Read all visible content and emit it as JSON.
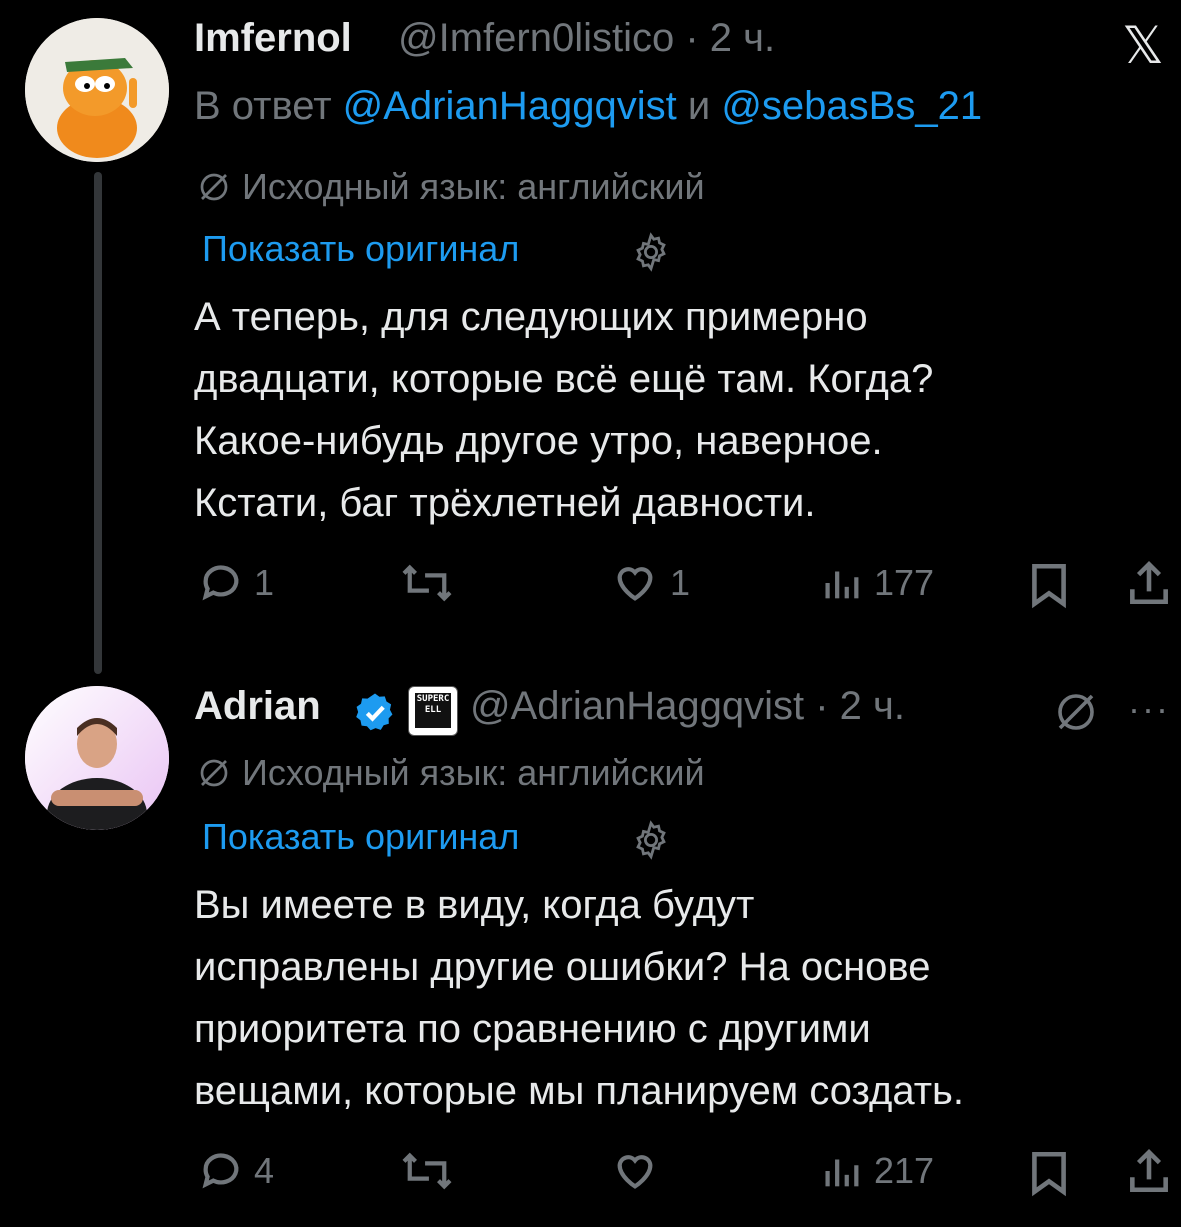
{
  "header": {
    "x_logo": "𝕏"
  },
  "tweet1": {
    "name": "Imfernol",
    "handle": "@Imfern0listico · 2 ч.",
    "reply_prefix": "В ответ ",
    "reply_mention1": "@AdrianHaggqvist",
    "reply_and": " и ",
    "reply_mention2": "@sebasBs_21",
    "lang": "Исходный язык: английский",
    "show_original": "Показать оригинал",
    "text": "А теперь, для следующих примерно\nдвадцати, которые всё ещё там. Когда?\nКакое-нибудь другое утро, наверное.\nКстати, баг трёхлетней давности.",
    "replies": "1",
    "likes": "1",
    "views": "177"
  },
  "tweet2": {
    "name": "Adrian",
    "org_badge": "SUPERCELL",
    "handle": "@AdrianHaggqvist · 2 ч.",
    "lang": "Исходный язык: английский",
    "show_original": "Показать оригинал",
    "text": "Вы имеете в виду, когда будут\nисправлены другие ошибки? На основе\nприоритета по сравнению с другими\nвещами, которые мы планируем создать.",
    "replies": "4",
    "views": "217",
    "more": "···"
  },
  "colors": {
    "accent": "#1d9bf0",
    "muted": "#71767b",
    "text": "#e7e9ea",
    "bg": "#000000"
  }
}
